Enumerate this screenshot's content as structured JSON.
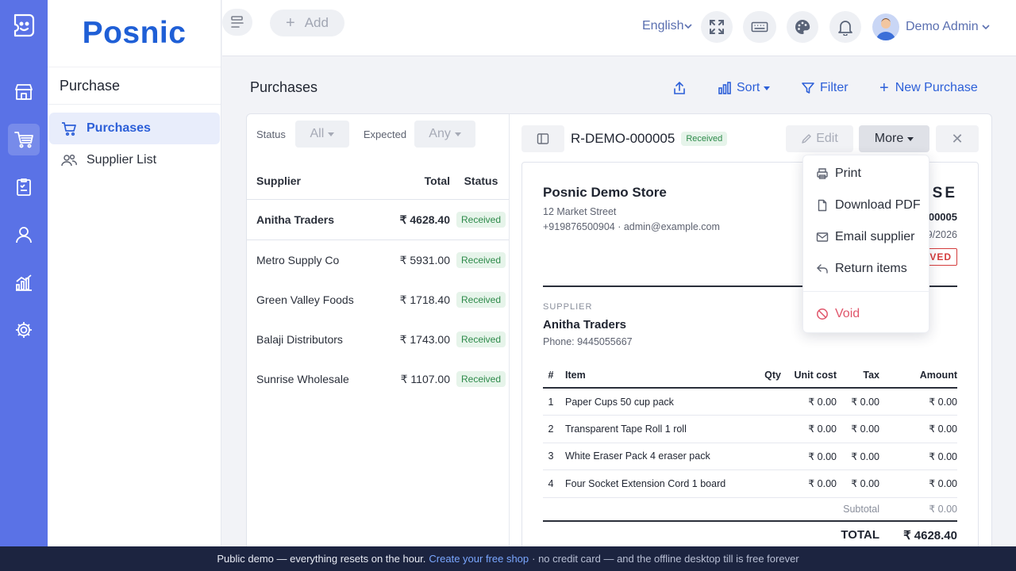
{
  "brand": {
    "name": "Posnic"
  },
  "colors": {
    "rail": "#5a72e6",
    "accent": "#2c5fd8",
    "badge_bg": "#e6f4ea",
    "badge_text": "#2d8a4a",
    "danger": "#e0566b",
    "banner_bg": "#1c2440"
  },
  "rail": {
    "items": [
      "store-icon",
      "cart-icon",
      "clipboard-icon",
      "user-icon",
      "chart-icon",
      "gear-icon"
    ],
    "active": "cart-icon"
  },
  "sidebar": {
    "section_title": "Purchase",
    "items": [
      {
        "label": "Purchases",
        "icon": "cart-icon",
        "active": true
      },
      {
        "label": "Supplier List",
        "icon": "users-icon",
        "active": false
      }
    ]
  },
  "topbar": {
    "add_label": "Add",
    "language": "English",
    "user_name": "Demo Admin",
    "icons": [
      "fullscreen-icon",
      "keyboard-icon",
      "palette-icon",
      "bell-icon"
    ]
  },
  "page": {
    "title": "Purchases",
    "actions": {
      "sort": "Sort",
      "filter": "Filter",
      "new": "New Purchase"
    }
  },
  "filters": {
    "status_label": "Status",
    "status_value": "All",
    "expected_label": "Expected",
    "expected_value": "Any"
  },
  "list": {
    "columns": {
      "supplier": "Supplier",
      "total": "Total",
      "status": "Status"
    },
    "rows": [
      {
        "supplier": "Anitha Traders",
        "total": "₹ 4628.40",
        "status": "Received"
      },
      {
        "supplier": "Metro Supply Co",
        "total": "₹ 5931.00",
        "status": "Received"
      },
      {
        "supplier": "Green Valley Foods",
        "total": "₹ 1718.40",
        "status": "Received"
      },
      {
        "supplier": "Balaji Distributors",
        "total": "₹ 1743.00",
        "status": "Received"
      },
      {
        "supplier": "Sunrise Wholesale",
        "total": "₹ 1107.00",
        "status": "Received"
      }
    ]
  },
  "detail": {
    "id": "R-DEMO-000005",
    "status": "Received",
    "edit_label": "Edit",
    "more_label": "More",
    "close_label": "✕",
    "store_name": "Posnic Demo Store",
    "store_address": "12 Market Street",
    "store_contact": "+919876500904 · admin@example.com",
    "doc_title_partial": "ASE",
    "doc_number_partial": "00005",
    "doc_date_partial": "9/2026",
    "doc_stamp_partial": "VED",
    "supplier_label": "SUPPLIER",
    "supplier_name": "Anitha Traders",
    "supplier_phone": "Phone: 9445055667",
    "items_header": {
      "n": "#",
      "item": "Item",
      "qty": "Qty",
      "unit_cost": "Unit cost",
      "tax": "Tax",
      "amount": "Amount"
    },
    "items": [
      {
        "n": "1",
        "item": "Paper Cups 50 cup pack",
        "qty": "",
        "unit_cost": "₹ 0.00",
        "tax": "₹ 0.00",
        "amount": "₹ 0.00"
      },
      {
        "n": "2",
        "item": "Transparent Tape Roll 1 roll",
        "qty": "",
        "unit_cost": "₹ 0.00",
        "tax": "₹ 0.00",
        "amount": "₹ 0.00"
      },
      {
        "n": "3",
        "item": "White Eraser Pack 4 eraser pack",
        "qty": "",
        "unit_cost": "₹ 0.00",
        "tax": "₹ 0.00",
        "amount": "₹ 0.00"
      },
      {
        "n": "4",
        "item": "Four Socket Extension Cord 1 board",
        "qty": "",
        "unit_cost": "₹ 0.00",
        "tax": "₹ 0.00",
        "amount": "₹ 0.00"
      }
    ],
    "subtotal_label": "Subtotal",
    "subtotal_value": "₹ 0.00",
    "total_label": "TOTAL",
    "total_value": "₹ 4628.40"
  },
  "more_menu": {
    "items": [
      {
        "label": "Print",
        "icon": "printer-icon"
      },
      {
        "label": "Download PDF",
        "icon": "file-icon"
      },
      {
        "label": "Email supplier",
        "icon": "mail-icon"
      },
      {
        "label": "Return items",
        "icon": "return-icon"
      }
    ],
    "danger_item": {
      "label": "Void",
      "icon": "ban-icon"
    }
  },
  "banner": {
    "text": "Public demo — everything resets on the hour.",
    "link": "Create your free shop",
    "tail": "· no credit card — and the offline desktop till is free forever"
  }
}
